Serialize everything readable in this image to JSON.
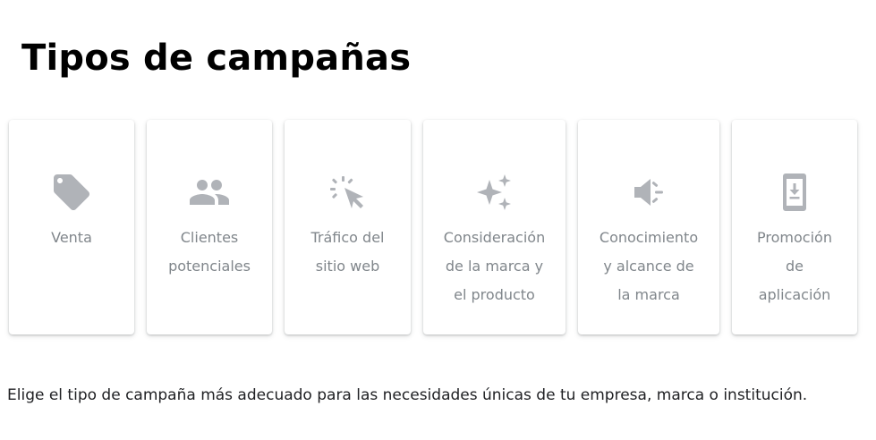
{
  "page": {
    "title": "Tipos de campañas",
    "description": "Elige el tipo de campaña más adecuado para las necesidades únicas de tu empresa, marca o institución."
  },
  "colors": {
    "icon": "#b0b3b8",
    "label": "#80868b",
    "title": "#000000",
    "text": "#202124"
  },
  "campaign_types": [
    {
      "icon": "tag-icon",
      "lines": [
        "Venta"
      ]
    },
    {
      "icon": "people-icon",
      "lines": [
        "Clientes",
        "potenciales"
      ]
    },
    {
      "icon": "cursor-click-icon",
      "lines": [
        "Tráfico del",
        "sitio web"
      ]
    },
    {
      "icon": "sparkle-icon",
      "lines": [
        "Consideración",
        "de la marca y",
        "el producto"
      ]
    },
    {
      "icon": "megaphone-icon",
      "lines": [
        "Conocimiento",
        "y alcance de",
        "la marca"
      ]
    },
    {
      "icon": "phone-download-icon",
      "lines": [
        "Promoción",
        "de",
        "aplicación"
      ]
    }
  ]
}
